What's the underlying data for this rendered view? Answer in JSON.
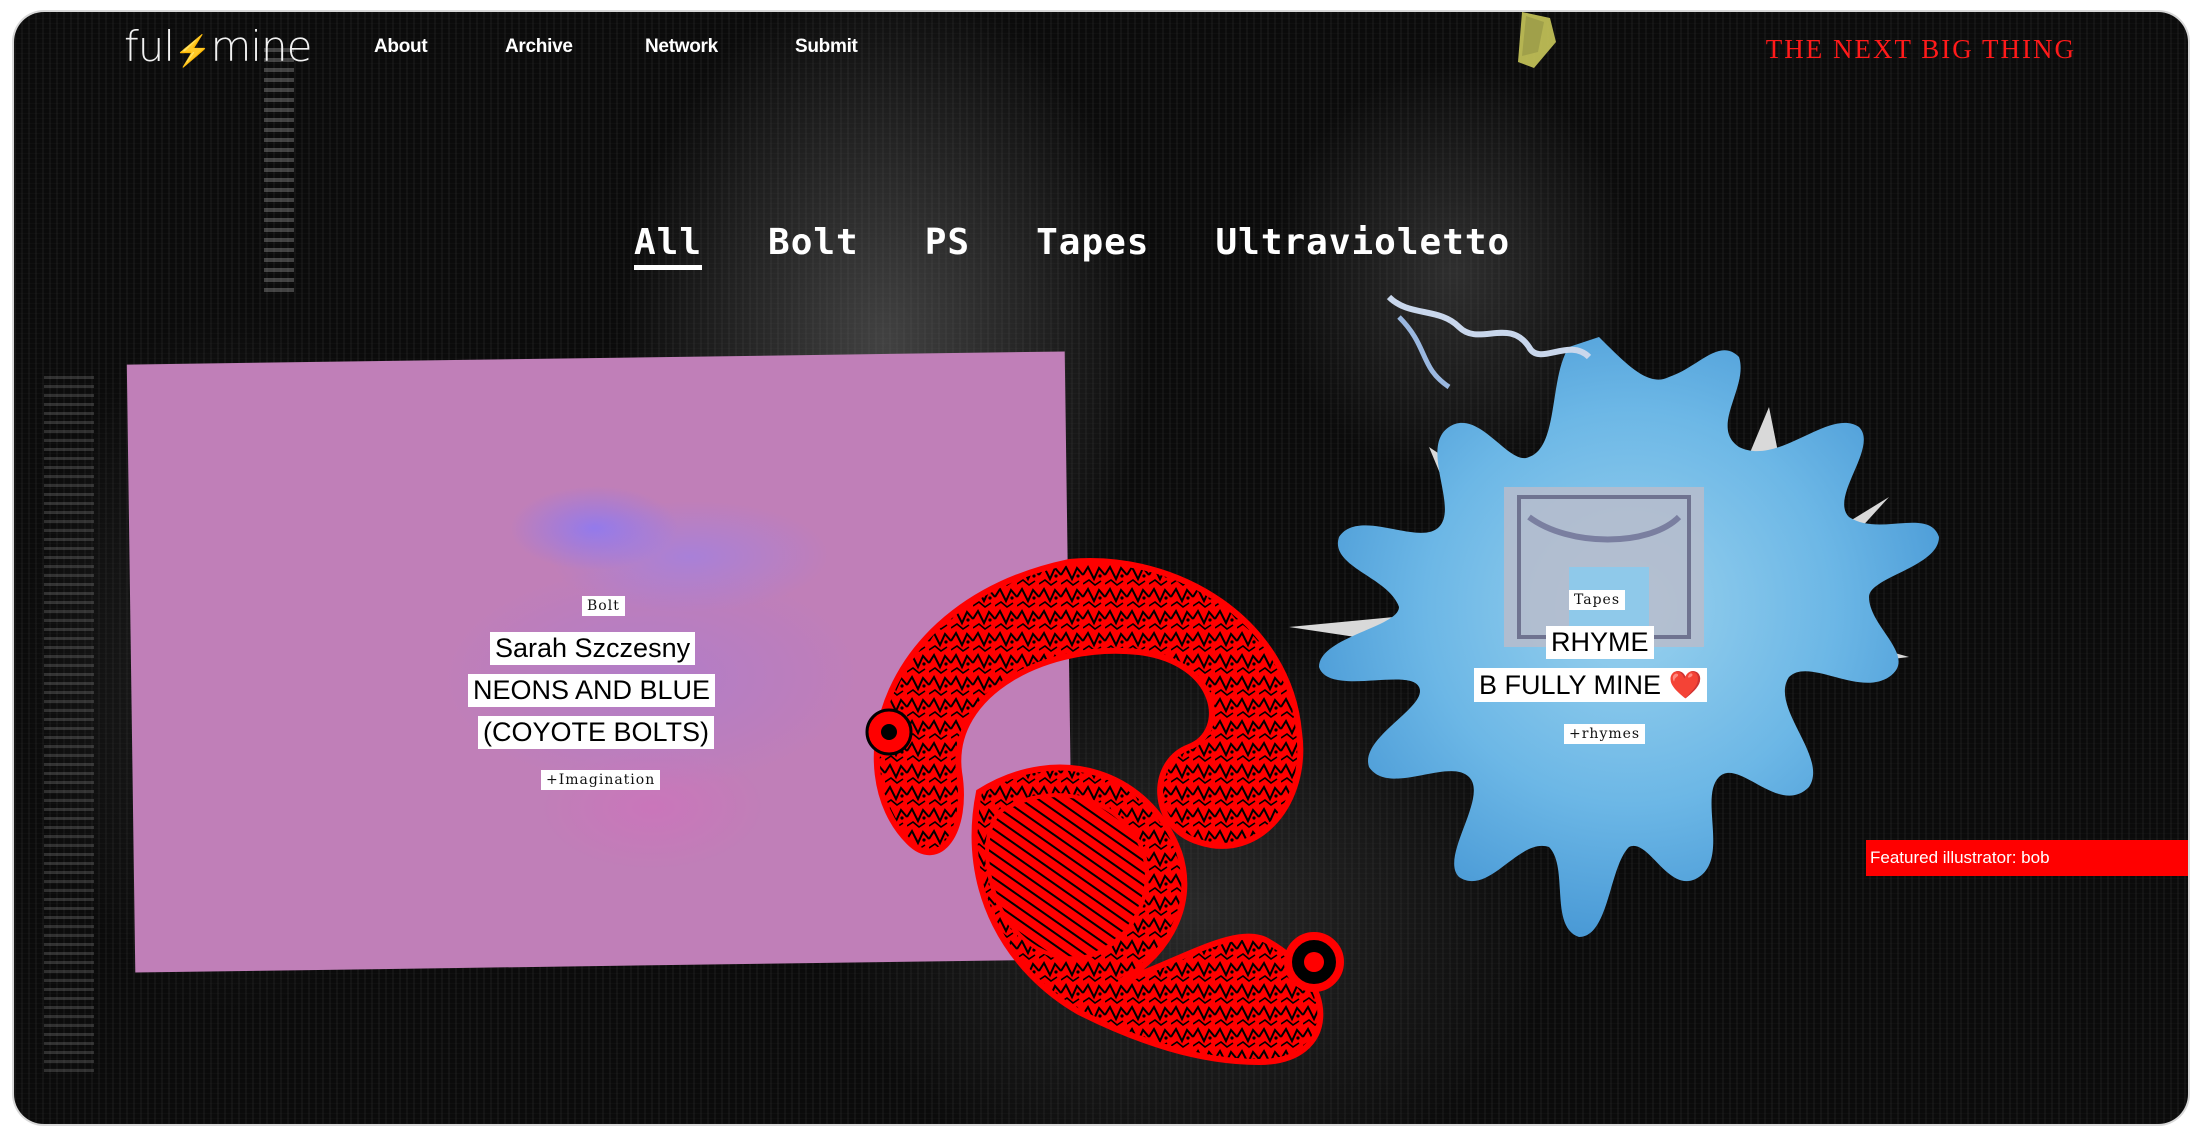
{
  "brand": {
    "logo_left": "ful",
    "logo_bolt": "⚡",
    "logo_right": "mine"
  },
  "nav": {
    "items": [
      "About",
      "Archive",
      "Network",
      "Submit"
    ]
  },
  "headline": "THE NEXT BIG THING",
  "filters": {
    "items": [
      "All",
      "Bolt",
      "PS",
      "Tapes",
      "Ultravioletto"
    ],
    "active": "All"
  },
  "cards": [
    {
      "category": "Bolt",
      "title_lines": [
        "Sarah Szczesny",
        "NEONS AND BLUE",
        "(COYOTE BOLTS)"
      ],
      "tag": "+Imagination"
    },
    {
      "category": "Tapes",
      "title_lines": [
        "RHYME",
        "B FULLY MINE ❤️"
      ],
      "tag": "+rhymes"
    }
  ],
  "featured": "Featured illustrator: bob",
  "colors": {
    "accent_red": "#ff1a1a",
    "card_pink": "#c07fb8",
    "splash_blue": "#7cc4ea"
  }
}
